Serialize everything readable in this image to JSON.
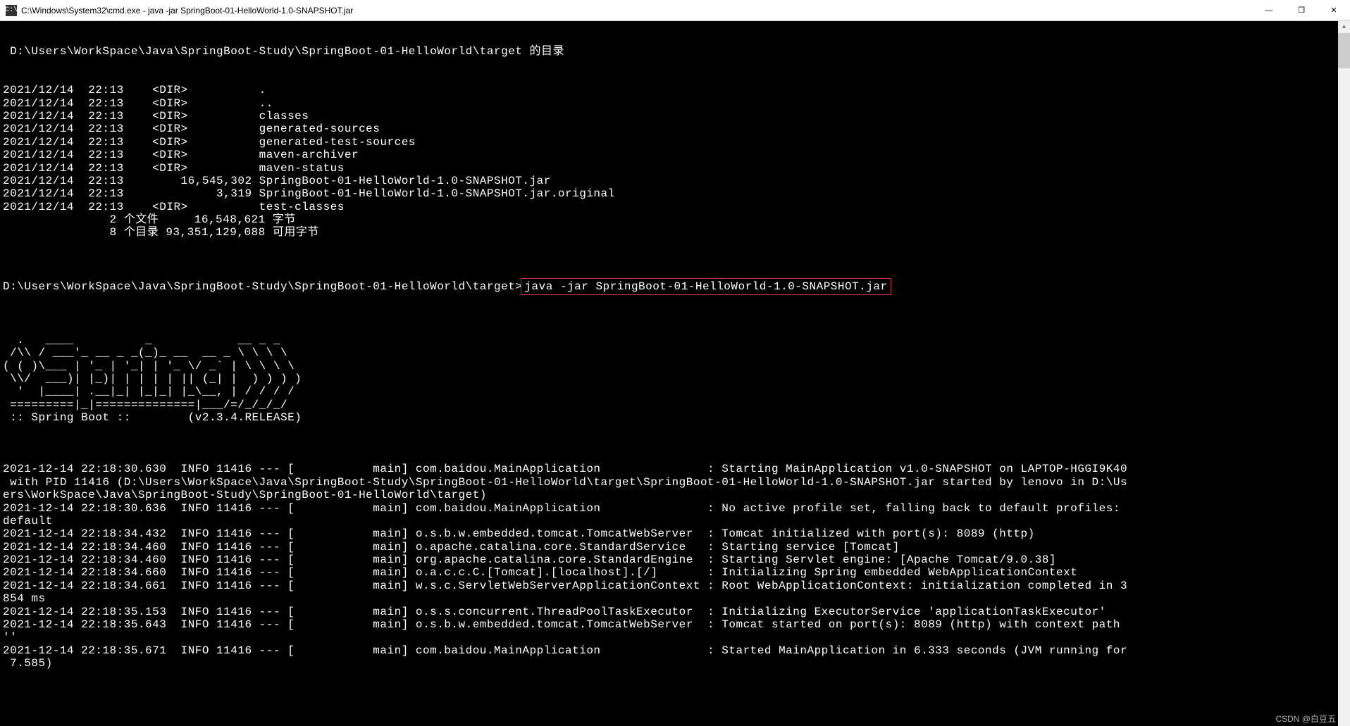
{
  "window": {
    "title": "C:\\Windows\\System32\\cmd.exe - java  -jar SpringBoot-01-HelloWorld-1.0-SNAPSHOT.jar",
    "icon_label": "cmd-icon"
  },
  "dir_header": " D:\\Users\\WorkSpace\\Java\\SpringBoot-Study\\SpringBoot-01-HelloWorld\\target 的目录",
  "dir_listing": "2021/12/14  22:13    <DIR>          .\n2021/12/14  22:13    <DIR>          ..\n2021/12/14  22:13    <DIR>          classes\n2021/12/14  22:13    <DIR>          generated-sources\n2021/12/14  22:13    <DIR>          generated-test-sources\n2021/12/14  22:13    <DIR>          maven-archiver\n2021/12/14  22:13    <DIR>          maven-status\n2021/12/14  22:13        16,545,302 SpringBoot-01-HelloWorld-1.0-SNAPSHOT.jar\n2021/12/14  22:13             3,319 SpringBoot-01-HelloWorld-1.0-SNAPSHOT.jar.original\n2021/12/14  22:13    <DIR>          test-classes\n               2 个文件     16,548,621 字节\n               8 个目录 93,351,129,088 可用字节",
  "prompt_line": {
    "prompt": "D:\\Users\\WorkSpace\\Java\\SpringBoot-Study\\SpringBoot-01-HelloWorld\\target>",
    "command": "java -jar SpringBoot-01-HelloWorld-1.0-SNAPSHOT.jar"
  },
  "spring_banner": "  .   ____          _            __ _ _\n /\\\\ / ___'_ __ _ _(_)_ __  __ _ \\ \\ \\ \\\n( ( )\\___ | '_ | '_| | '_ \\/ _` | \\ \\ \\ \\\n \\\\/  ___)| |_)| | | | | || (_| |  ) ) ) )\n  '  |____| .__|_| |_|_| |_\\__, | / / / /\n =========|_|==============|___/=/_/_/_/\n :: Spring Boot ::        (v2.3.4.RELEASE)",
  "log_output": "2021-12-14 22:18:30.630  INFO 11416 --- [           main] com.baidou.MainApplication               : Starting MainApplication v1.0-SNAPSHOT on LAPTOP-HGGI9K40\n with PID 11416 (D:\\Users\\WorkSpace\\Java\\SpringBoot-Study\\SpringBoot-01-HelloWorld\\target\\SpringBoot-01-HelloWorld-1.0-SNAPSHOT.jar started by lenovo in D:\\Us\ners\\WorkSpace\\Java\\SpringBoot-Study\\SpringBoot-01-HelloWorld\\target)\n2021-12-14 22:18:30.636  INFO 11416 --- [           main] com.baidou.MainApplication               : No active profile set, falling back to default profiles:\ndefault\n2021-12-14 22:18:34.432  INFO 11416 --- [           main] o.s.b.w.embedded.tomcat.TomcatWebServer  : Tomcat initialized with port(s): 8089 (http)\n2021-12-14 22:18:34.460  INFO 11416 --- [           main] o.apache.catalina.core.StandardService   : Starting service [Tomcat]\n2021-12-14 22:18:34.460  INFO 11416 --- [           main] org.apache.catalina.core.StandardEngine  : Starting Servlet engine: [Apache Tomcat/9.0.38]\n2021-12-14 22:18:34.660  INFO 11416 --- [           main] o.a.c.c.C.[Tomcat].[localhost].[/]       : Initializing Spring embedded WebApplicationContext\n2021-12-14 22:18:34.661  INFO 11416 --- [           main] w.s.c.ServletWebServerApplicationContext : Root WebApplicationContext: initialization completed in 3\n854 ms\n2021-12-14 22:18:35.153  INFO 11416 --- [           main] o.s.s.concurrent.ThreadPoolTaskExecutor  : Initializing ExecutorService 'applicationTaskExecutor'\n2021-12-14 22:18:35.643  INFO 11416 --- [           main] o.s.b.w.embedded.tomcat.TomcatWebServer  : Tomcat started on port(s): 8089 (http) with context path\n''\n2021-12-14 22:18:35.671  INFO 11416 --- [           main] com.baidou.MainApplication               : Started MainApplication in 6.333 seconds (JVM running for\n 7.585)",
  "watermark": "CSDN @白豆五"
}
